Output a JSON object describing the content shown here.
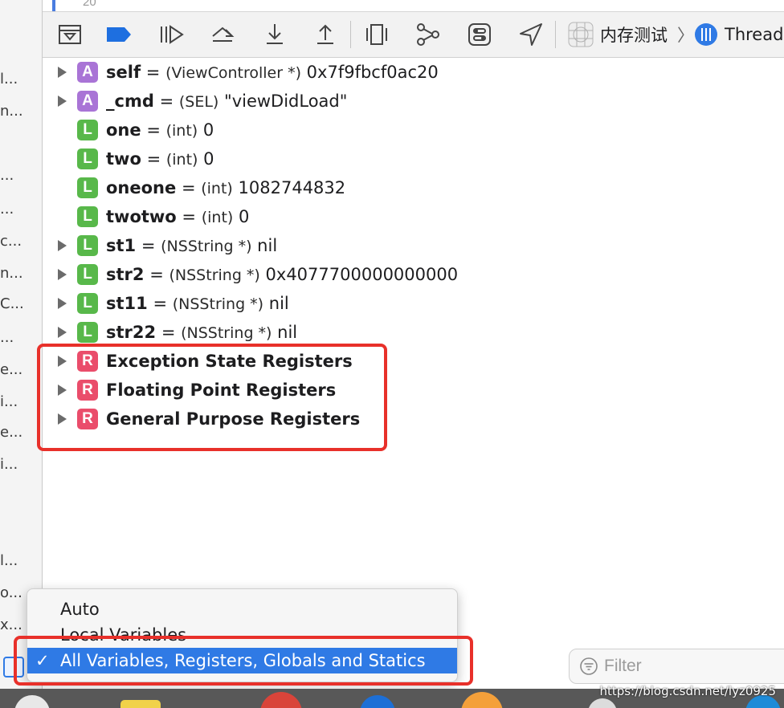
{
  "colors": {
    "argument_badge": "#a974d6",
    "local_badge": "#58b84a",
    "register_badge": "#ea4d6b",
    "highlight": "#e8302a",
    "selection": "#2f7ae5"
  },
  "editor": {
    "line_number": "20"
  },
  "left_fragments": [
    "l...",
    "n...",
    "...",
    "...",
    "c...",
    "n...",
    "C...",
    "...",
    "e...",
    "i...",
    "e...",
    "i...",
    "l...",
    "o...",
    "x..."
  ],
  "toolbar": {
    "buttons": [
      {
        "icon": "hide-debug-area-icon"
      },
      {
        "icon": "breakpoints-toggle-icon"
      },
      {
        "icon": "continue-icon"
      },
      {
        "icon": "step-over-icon"
      },
      {
        "icon": "step-into-icon"
      },
      {
        "icon": "step-out-icon"
      },
      {
        "icon": "view-hierarchy-icon"
      },
      {
        "icon": "memory-graph-icon"
      },
      {
        "icon": "environment-overrides-icon"
      },
      {
        "icon": "simulate-location-icon"
      }
    ],
    "breadcrumb": {
      "app_name": "内存测试",
      "separator": "〉",
      "thread_label": "Thread"
    }
  },
  "variables": [
    {
      "kind": "A",
      "expandable": true,
      "name": "self",
      "eq": "=",
      "type": "(ViewController *)",
      "value": "0x7f9fbcf0ac20"
    },
    {
      "kind": "A",
      "expandable": true,
      "name": "_cmd",
      "eq": "=",
      "type": "(SEL)",
      "value": "\"viewDidLoad\""
    },
    {
      "kind": "L",
      "expandable": false,
      "name": "one",
      "eq": "=",
      "type": "(int)",
      "value": "0"
    },
    {
      "kind": "L",
      "expandable": false,
      "name": "two",
      "eq": "=",
      "type": "(int)",
      "value": "0"
    },
    {
      "kind": "L",
      "expandable": false,
      "name": "oneone",
      "eq": "=",
      "type": "(int)",
      "value": "1082744832"
    },
    {
      "kind": "L",
      "expandable": false,
      "name": "twotwo",
      "eq": "=",
      "type": "(int)",
      "value": "0"
    },
    {
      "kind": "L",
      "expandable": true,
      "name": "st1",
      "eq": "=",
      "type": "(NSString *)",
      "value": "nil"
    },
    {
      "kind": "L",
      "expandable": true,
      "name": "str2",
      "eq": "=",
      "type": "(NSString *)",
      "value": "0x4077700000000000"
    },
    {
      "kind": "L",
      "expandable": true,
      "name": "st11",
      "eq": "=",
      "type": "(NSString *)",
      "value": "nil"
    },
    {
      "kind": "L",
      "expandable": true,
      "name": "str22",
      "eq": "=",
      "type": "(NSString *)",
      "value": "nil"
    }
  ],
  "registers": [
    {
      "kind": "R",
      "name": "Exception State Registers"
    },
    {
      "kind": "R",
      "name": "Floating Point Registers"
    },
    {
      "kind": "R",
      "name": "General Purpose Registers"
    }
  ],
  "scope_menu": {
    "items": [
      {
        "label": "Auto",
        "selected": false
      },
      {
        "label": "Local Variables",
        "selected": false
      },
      {
        "label": "All Variables, Registers, Globals and Statics",
        "selected": true
      }
    ],
    "check_mark": "✓"
  },
  "filter": {
    "placeholder": "Filter"
  },
  "watermark": "https://blog.csdn.net/lyz0925"
}
